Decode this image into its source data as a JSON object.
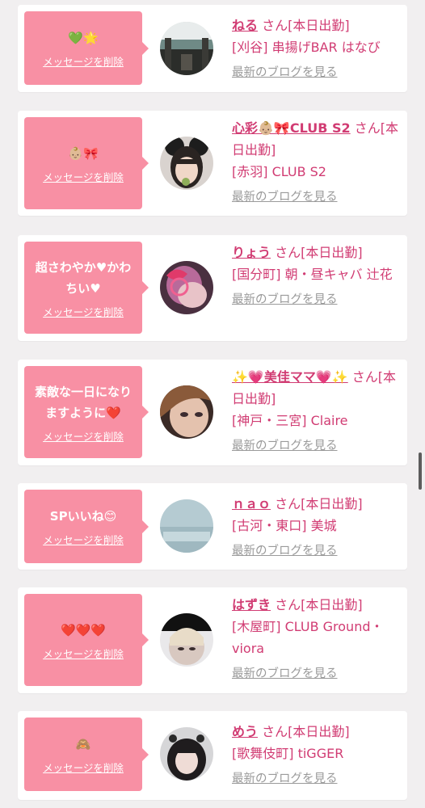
{
  "list": {
    "delete_label": "メッセージを削除",
    "blog_label": "最新のブログを見る",
    "items": [
      {
        "message": "💚🌟",
        "name": "ねる",
        "suffix": " さん[本日出勤]",
        "shop": "[刈谷] 串揚げBAR はなび"
      },
      {
        "message": "👶🏼🎀",
        "name": "心彩👶🏼🎀CLUB S2",
        "suffix": " さん[本日出勤]",
        "shop": "[赤羽] CLUB S2"
      },
      {
        "message": "超さわやか♥かわ\nちい♥",
        "name": "りょう",
        "suffix": " さん[本日出勤]",
        "shop": "[国分町] 朝・昼キャバ 辻花"
      },
      {
        "message": "素敵な一日になり\nますように❤️",
        "name": "✨💗美佳ママ💗✨",
        "suffix": " さん[本日出勤]",
        "shop": "[神戸・三宮] Claire"
      },
      {
        "message": "SPいいね😊",
        "name": "ｎａｏ",
        "suffix": " さん[本日出勤]",
        "shop": "[古河・東口] 美城"
      },
      {
        "message": "❤️❤️❤️",
        "name": "はずき",
        "suffix": " さん[本日出勤]",
        "shop": "[木屋町] CLUB Ground・viora"
      },
      {
        "message": "🙈",
        "name": "めう",
        "suffix": " さん[本日出勤]",
        "shop": "[歌舞伎町] tiGGER"
      }
    ]
  },
  "colors": {
    "accent": "#d13c73",
    "bubble": "#f890a4",
    "background": "#f1eff0"
  }
}
